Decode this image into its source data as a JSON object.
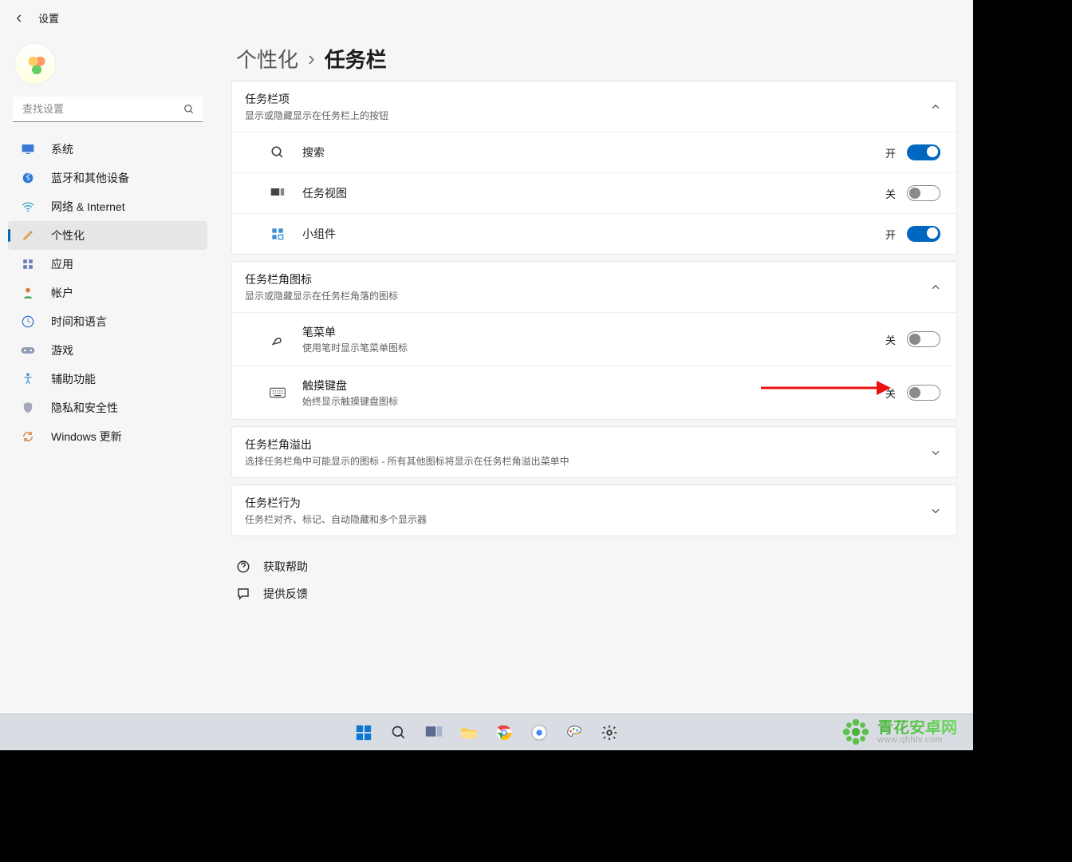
{
  "header": {
    "title": "设置"
  },
  "search": {
    "placeholder": "查找设置"
  },
  "sidebar": {
    "items": [
      {
        "id": "system",
        "label": "系统"
      },
      {
        "id": "bluetooth",
        "label": "蓝牙和其他设备"
      },
      {
        "id": "network",
        "label": "网络 & Internet"
      },
      {
        "id": "personalization",
        "label": "个性化"
      },
      {
        "id": "apps",
        "label": "应用"
      },
      {
        "id": "accounts",
        "label": "帐户"
      },
      {
        "id": "time",
        "label": "时间和语言"
      },
      {
        "id": "gaming",
        "label": "游戏"
      },
      {
        "id": "accessibility",
        "label": "辅助功能"
      },
      {
        "id": "privacy",
        "label": "隐私和安全性"
      },
      {
        "id": "update",
        "label": "Windows 更新"
      }
    ],
    "active": "personalization"
  },
  "breadcrumb": {
    "parent": "个性化",
    "current": "任务栏"
  },
  "sections": {
    "items": {
      "title": "任务栏项",
      "subtitle": "显示或隐藏显示在任务栏上的按钮",
      "rows": [
        {
          "id": "search",
          "label": "搜索",
          "state": "开",
          "on": true
        },
        {
          "id": "taskview",
          "label": "任务视图",
          "state": "关",
          "on": false
        },
        {
          "id": "widgets",
          "label": "小组件",
          "state": "开",
          "on": true
        }
      ]
    },
    "corner": {
      "title": "任务栏角图标",
      "subtitle": "显示或隐藏显示在任务栏角落的图标",
      "rows": [
        {
          "id": "pen",
          "label": "笔菜单",
          "sub": "使用笔时显示笔菜单图标",
          "state": "关",
          "on": false
        },
        {
          "id": "touchkb",
          "label": "触摸键盘",
          "sub": "始终显示触摸键盘图标",
          "state": "关",
          "on": false
        }
      ]
    },
    "overflow": {
      "title": "任务栏角溢出",
      "subtitle": "选择任务栏角中可能显示的图标 - 所有其他图标将显示在任务栏角溢出菜单中"
    },
    "behavior": {
      "title": "任务栏行为",
      "subtitle": "任务栏对齐、标记、自动隐藏和多个显示器"
    }
  },
  "footer": {
    "help": "获取帮助",
    "feedback": "提供反馈"
  },
  "watermark": {
    "title": "青花安卓网",
    "url": "www.qhhlv.com"
  }
}
